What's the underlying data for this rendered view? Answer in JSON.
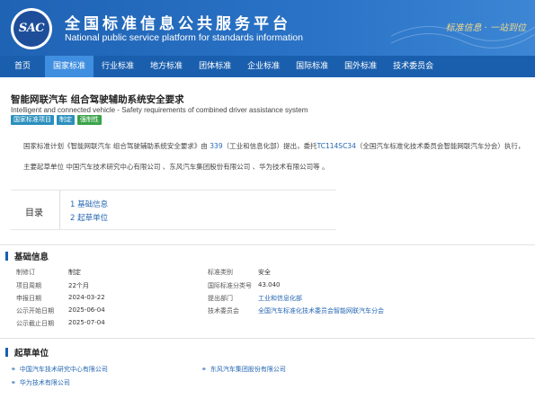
{
  "header": {
    "logo_text": "SAC",
    "title": "全国标准信息公共服务平台",
    "subtitle": "National public service platform  for standards information",
    "slogan": "标准信息 · 一站到位"
  },
  "nav": [
    {
      "label": "首页",
      "active": false
    },
    {
      "label": "国家标准",
      "active": true
    },
    {
      "label": "行业标准",
      "active": false
    },
    {
      "label": "地方标准",
      "active": false
    },
    {
      "label": "团体标准",
      "active": false
    },
    {
      "label": "企业标准",
      "active": false
    },
    {
      "label": "国际标准",
      "active": false
    },
    {
      "label": "国外标准",
      "active": false
    },
    {
      "label": "技术委员会",
      "active": false
    }
  ],
  "standard": {
    "title": "智能网联汽车 组合驾驶辅助系统安全要求",
    "title_en": "Intelligent and connected vehicle - Safety requirements of combined driver assistance system",
    "badges": [
      "国家标准项目",
      "制定",
      "强制性"
    ],
    "plan_prefix": "国家标准计划《智能网联汽车 组合驾驶辅助系统安全要求》由 ",
    "plan_num": "339",
    "plan_mid": "（工业和信息化部）提出，委托",
    "plan_tc": "TC114SC34",
    "plan_suffix": "（全国汽车标准化技术委员会智能网联汽车分会）执行，",
    "drafters_line": "主要起草单位 中国汽车技术研究中心有限公司 、东风汽车集团股份有限公司 、华为技术有限公司等 。"
  },
  "toc": {
    "label": "目录",
    "items": [
      "1  基础信息",
      "2  起草单位"
    ]
  },
  "basic": {
    "title": "基础信息",
    "rows": [
      {
        "l1": "制修订",
        "v1": "制定",
        "l2": "标准类别",
        "v2": "安全"
      },
      {
        "l1": "项目周期",
        "v1": "22个月",
        "l2": "国际标准分类号",
        "v2": "43.040"
      },
      {
        "l1": "申报日期",
        "v1": "2024-03-22",
        "l2": "提出部门",
        "v2": "工业和信息化部"
      },
      {
        "l1": "公示开始日期",
        "v1": "2025-06-04",
        "l2": "技术委员会",
        "v2": "全国汽车标准化技术委员会智能网联汽车分会"
      },
      {
        "l1": "公示截止日期",
        "v1": "2025-07-04",
        "l2": "",
        "v2": ""
      }
    ]
  },
  "drafters": {
    "title": "起草单位",
    "items": [
      "中国汽车技术研究中心有限公司",
      "东风汽车集团股份有限公司",
      "华为技术有限公司"
    ]
  }
}
